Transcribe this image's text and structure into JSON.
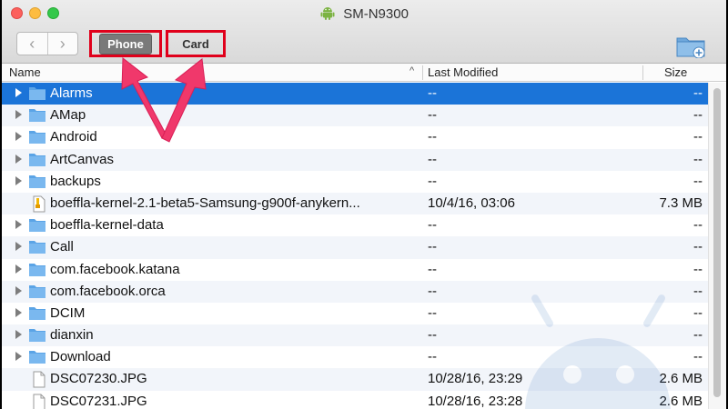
{
  "window": {
    "title": "SM-N9300",
    "icons": {
      "title_icon": "android-icon",
      "new_folder": "new-folder-icon"
    }
  },
  "toolbar": {
    "back_label": "‹",
    "forward_label": "›",
    "phone_label": "Phone",
    "card_label": "Card"
  },
  "columns": {
    "name": "Name",
    "sort_indicator": "^",
    "last_modified": "Last Modified",
    "size": "Size"
  },
  "colors": {
    "selection": "#1b74d8",
    "highlight_box": "#e0001b",
    "arrow": "#f0386b"
  },
  "rows": [
    {
      "type": "folder",
      "name": "Alarms",
      "modified": "--",
      "size": "--",
      "selected": true
    },
    {
      "type": "folder",
      "name": "AMap",
      "modified": "--",
      "size": "--"
    },
    {
      "type": "folder",
      "name": "Android",
      "modified": "--",
      "size": "--"
    },
    {
      "type": "folder",
      "name": "ArtCanvas",
      "modified": "--",
      "size": "--"
    },
    {
      "type": "folder",
      "name": "backups",
      "modified": "--",
      "size": "--"
    },
    {
      "type": "zip",
      "name": "boeffla-kernel-2.1-beta5-Samsung-g900f-anykern...",
      "modified": "10/4/16, 03:06",
      "size": "7.3 MB"
    },
    {
      "type": "folder",
      "name": "boeffla-kernel-data",
      "modified": "--",
      "size": "--"
    },
    {
      "type": "folder",
      "name": "Call",
      "modified": "--",
      "size": "--"
    },
    {
      "type": "folder",
      "name": "com.facebook.katana",
      "modified": "--",
      "size": "--"
    },
    {
      "type": "folder",
      "name": "com.facebook.orca",
      "modified": "--",
      "size": "--"
    },
    {
      "type": "folder",
      "name": "DCIM",
      "modified": "--",
      "size": "--"
    },
    {
      "type": "folder",
      "name": "dianxin",
      "modified": "--",
      "size": "--"
    },
    {
      "type": "folder",
      "name": "Download",
      "modified": "--",
      "size": "--"
    },
    {
      "type": "file",
      "name": "DSC07230.JPG",
      "modified": "10/28/16, 23:29",
      "size": "2.6 MB"
    },
    {
      "type": "file",
      "name": "DSC07231.JPG",
      "modified": "10/28/16, 23:28",
      "size": "2.6 MB"
    }
  ]
}
